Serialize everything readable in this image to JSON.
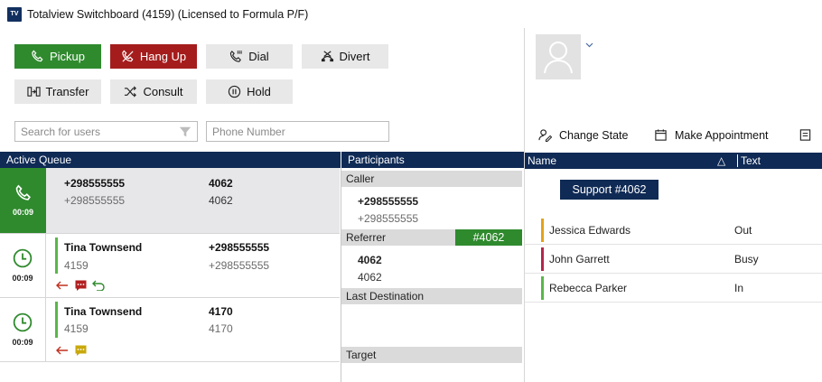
{
  "window": {
    "title": "Totalview Switchboard (4159) (Licensed to Formula P/F)",
    "logo": "TV"
  },
  "toolbar": {
    "pickup": "Pickup",
    "hangup": "Hang Up",
    "dial": "Dial",
    "divert": "Divert",
    "transfer": "Transfer",
    "consult": "Consult",
    "hold": "Hold"
  },
  "search": {
    "users_placeholder": "Search for users",
    "phone_placeholder": "Phone Number"
  },
  "queue": {
    "header": "Active Queue",
    "rows": [
      {
        "time": "00:09",
        "name": "+298555555",
        "sub": "+298555555",
        "num": "4062",
        "num_sub": "4062"
      },
      {
        "time": "00:09",
        "name": "Tina Townsend",
        "sub": "4159",
        "num": "+298555555",
        "num_sub": "+298555555"
      },
      {
        "time": "00:09",
        "name": "Tina Townsend",
        "sub": "4159",
        "num": "4170",
        "num_sub": "4170"
      }
    ]
  },
  "participants": {
    "header": "Participants",
    "caller_label": "Caller",
    "caller_main": "+298555555",
    "caller_sub": "+298555555",
    "referrer_label": "Referrer",
    "referrer_tag": "#4062",
    "referrer_main": "4062",
    "referrer_sub": "4062",
    "last_destination_label": "Last Destination",
    "target_label": "Target"
  },
  "right_panel": {
    "actions": {
      "change_state": "Change State",
      "make_appointment": "Make Appointment"
    },
    "columns": {
      "name": "Name",
      "text": "Text"
    },
    "group": "Support #4062",
    "people": [
      {
        "name": "Jessica Edwards",
        "state": "Out",
        "color": "#e3a21a"
      },
      {
        "name": "John Garrett",
        "state": "Busy",
        "color": "#b3264a"
      },
      {
        "name": "Rebecca Parker",
        "state": "In",
        "color": "#5bb64a"
      }
    ]
  },
  "colors": {
    "navy": "#0f2a55",
    "green": "#2f8a2e",
    "red": "#a51c1c"
  }
}
